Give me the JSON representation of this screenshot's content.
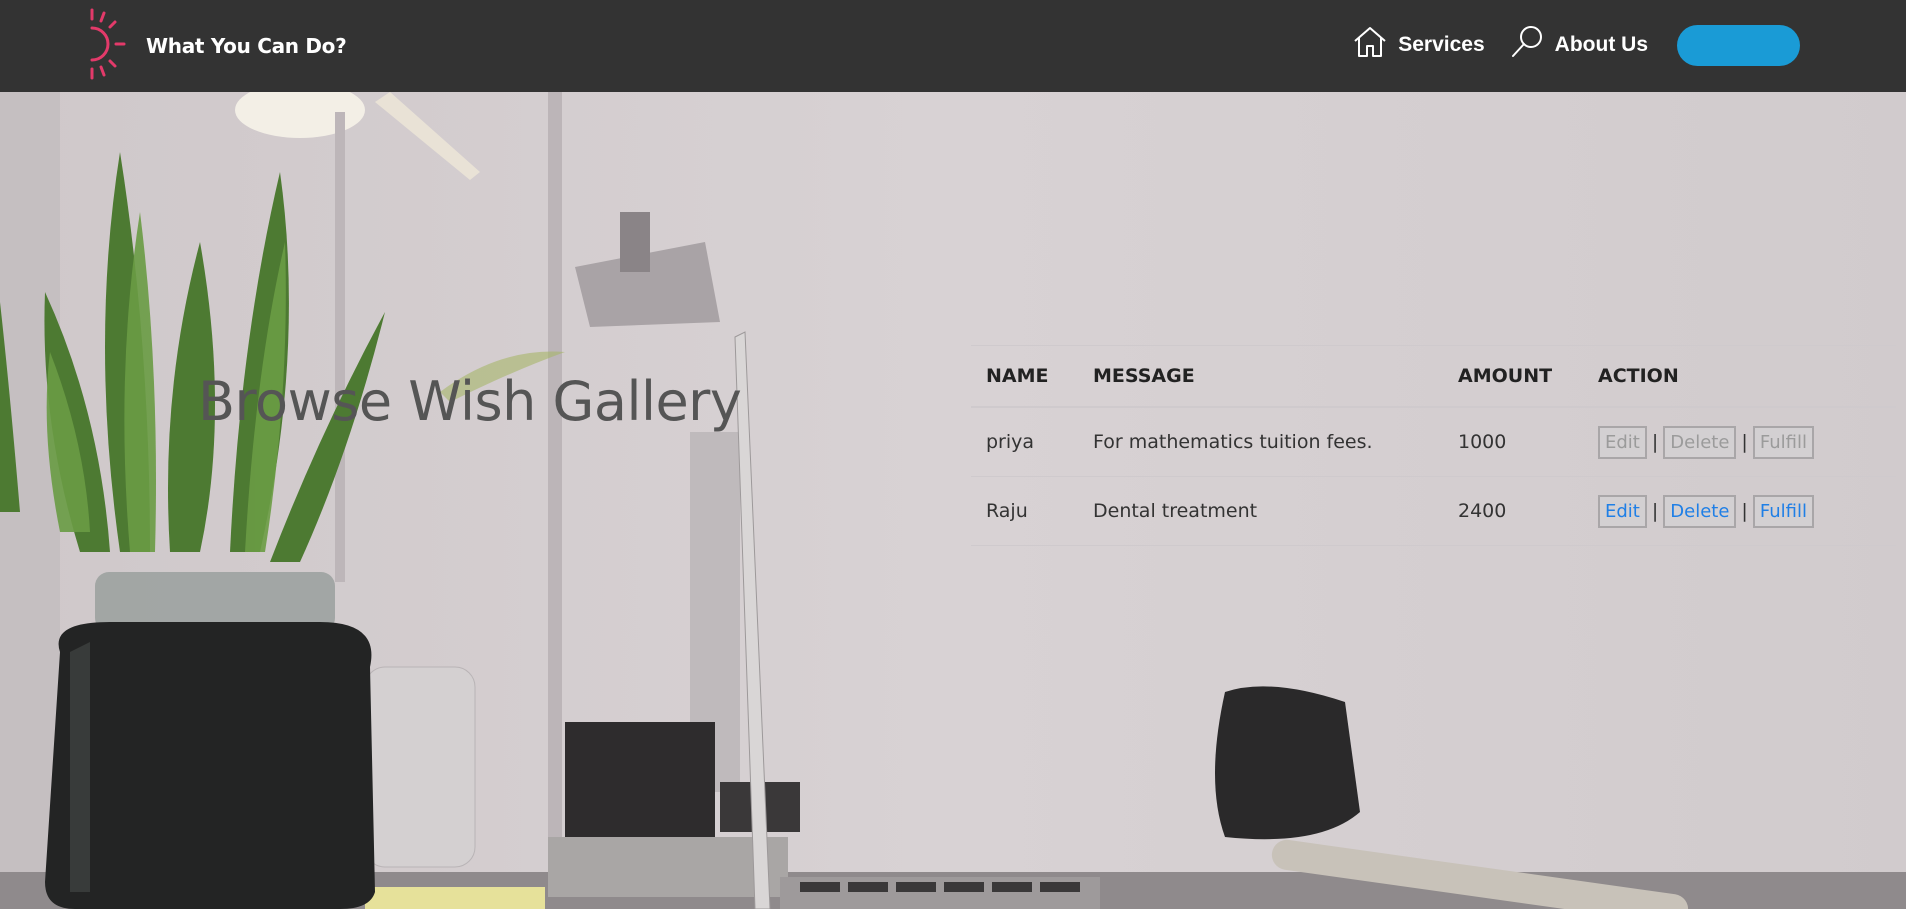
{
  "brand": {
    "title": "What You Can Do?",
    "logo_icon": "sun-icon",
    "logo_color": "#e33a6a"
  },
  "nav": {
    "items": [
      {
        "label": "Services",
        "icon": "home-icon"
      },
      {
        "label": "About Us",
        "icon": "search-icon"
      }
    ],
    "button_label": "",
    "button_color": "#1a9bd6"
  },
  "main": {
    "title": "Browse Wish Gallery"
  },
  "table": {
    "headers": [
      "NAME",
      "MESSAGE",
      "AMOUNT",
      "ACTION"
    ],
    "rows": [
      {
        "name": "priya",
        "message": "For mathematics tuition fees.",
        "amount": "1000",
        "actions": [
          "Edit",
          "Delete",
          "Fulfill"
        ],
        "separator": "|",
        "enabled": false
      },
      {
        "name": "Raju",
        "message": "Dental treatment",
        "amount": "2400",
        "actions": [
          "Edit",
          "Delete",
          "Fulfill"
        ],
        "separator": "|",
        "enabled": true
      }
    ]
  },
  "colors": {
    "navbar": "#333333",
    "link_blue": "#1f7fe6",
    "disabled_gray": "#9b9b9b"
  }
}
